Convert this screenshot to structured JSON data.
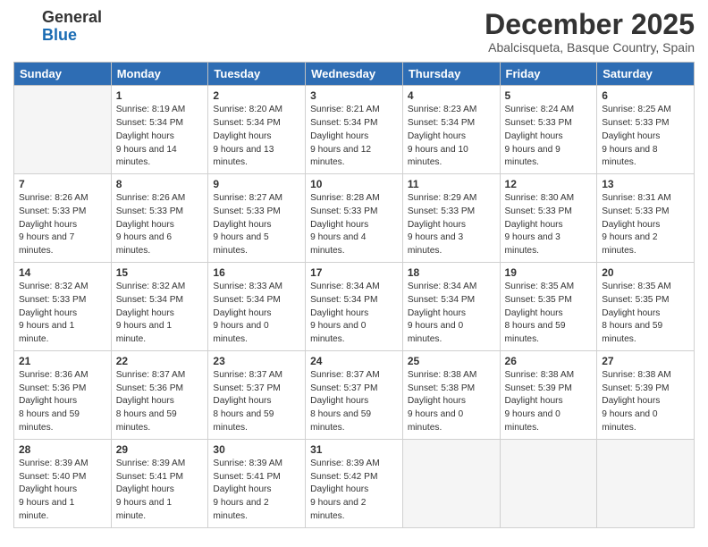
{
  "logo": {
    "general": "General",
    "blue": "Blue"
  },
  "title": "December 2025",
  "subtitle": "Abalcisqueta, Basque Country, Spain",
  "days": [
    "Sunday",
    "Monday",
    "Tuesday",
    "Wednesday",
    "Thursday",
    "Friday",
    "Saturday"
  ],
  "weeks": [
    [
      {
        "num": "",
        "sunrise": "",
        "sunset": "",
        "daylight": "",
        "empty": true
      },
      {
        "num": "1",
        "sunrise": "8:19 AM",
        "sunset": "5:34 PM",
        "daylight": "9 hours and 14 minutes."
      },
      {
        "num": "2",
        "sunrise": "8:20 AM",
        "sunset": "5:34 PM",
        "daylight": "9 hours and 13 minutes."
      },
      {
        "num": "3",
        "sunrise": "8:21 AM",
        "sunset": "5:34 PM",
        "daylight": "9 hours and 12 minutes."
      },
      {
        "num": "4",
        "sunrise": "8:23 AM",
        "sunset": "5:34 PM",
        "daylight": "9 hours and 10 minutes."
      },
      {
        "num": "5",
        "sunrise": "8:24 AM",
        "sunset": "5:33 PM",
        "daylight": "9 hours and 9 minutes."
      },
      {
        "num": "6",
        "sunrise": "8:25 AM",
        "sunset": "5:33 PM",
        "daylight": "9 hours and 8 minutes."
      }
    ],
    [
      {
        "num": "7",
        "sunrise": "8:26 AM",
        "sunset": "5:33 PM",
        "daylight": "9 hours and 7 minutes."
      },
      {
        "num": "8",
        "sunrise": "8:26 AM",
        "sunset": "5:33 PM",
        "daylight": "9 hours and 6 minutes."
      },
      {
        "num": "9",
        "sunrise": "8:27 AM",
        "sunset": "5:33 PM",
        "daylight": "9 hours and 5 minutes."
      },
      {
        "num": "10",
        "sunrise": "8:28 AM",
        "sunset": "5:33 PM",
        "daylight": "9 hours and 4 minutes."
      },
      {
        "num": "11",
        "sunrise": "8:29 AM",
        "sunset": "5:33 PM",
        "daylight": "9 hours and 3 minutes."
      },
      {
        "num": "12",
        "sunrise": "8:30 AM",
        "sunset": "5:33 PM",
        "daylight": "9 hours and 3 minutes."
      },
      {
        "num": "13",
        "sunrise": "8:31 AM",
        "sunset": "5:33 PM",
        "daylight": "9 hours and 2 minutes."
      }
    ],
    [
      {
        "num": "14",
        "sunrise": "8:32 AM",
        "sunset": "5:33 PM",
        "daylight": "9 hours and 1 minute."
      },
      {
        "num": "15",
        "sunrise": "8:32 AM",
        "sunset": "5:34 PM",
        "daylight": "9 hours and 1 minute."
      },
      {
        "num": "16",
        "sunrise": "8:33 AM",
        "sunset": "5:34 PM",
        "daylight": "9 hours and 0 minutes."
      },
      {
        "num": "17",
        "sunrise": "8:34 AM",
        "sunset": "5:34 PM",
        "daylight": "9 hours and 0 minutes."
      },
      {
        "num": "18",
        "sunrise": "8:34 AM",
        "sunset": "5:34 PM",
        "daylight": "9 hours and 0 minutes."
      },
      {
        "num": "19",
        "sunrise": "8:35 AM",
        "sunset": "5:35 PM",
        "daylight": "8 hours and 59 minutes."
      },
      {
        "num": "20",
        "sunrise": "8:35 AM",
        "sunset": "5:35 PM",
        "daylight": "8 hours and 59 minutes."
      }
    ],
    [
      {
        "num": "21",
        "sunrise": "8:36 AM",
        "sunset": "5:36 PM",
        "daylight": "8 hours and 59 minutes."
      },
      {
        "num": "22",
        "sunrise": "8:37 AM",
        "sunset": "5:36 PM",
        "daylight": "8 hours and 59 minutes."
      },
      {
        "num": "23",
        "sunrise": "8:37 AM",
        "sunset": "5:37 PM",
        "daylight": "8 hours and 59 minutes."
      },
      {
        "num": "24",
        "sunrise": "8:37 AM",
        "sunset": "5:37 PM",
        "daylight": "8 hours and 59 minutes."
      },
      {
        "num": "25",
        "sunrise": "8:38 AM",
        "sunset": "5:38 PM",
        "daylight": "9 hours and 0 minutes."
      },
      {
        "num": "26",
        "sunrise": "8:38 AM",
        "sunset": "5:39 PM",
        "daylight": "9 hours and 0 minutes."
      },
      {
        "num": "27",
        "sunrise": "8:38 AM",
        "sunset": "5:39 PM",
        "daylight": "9 hours and 0 minutes."
      }
    ],
    [
      {
        "num": "28",
        "sunrise": "8:39 AM",
        "sunset": "5:40 PM",
        "daylight": "9 hours and 1 minute."
      },
      {
        "num": "29",
        "sunrise": "8:39 AM",
        "sunset": "5:41 PM",
        "daylight": "9 hours and 1 minute."
      },
      {
        "num": "30",
        "sunrise": "8:39 AM",
        "sunset": "5:41 PM",
        "daylight": "9 hours and 2 minutes."
      },
      {
        "num": "31",
        "sunrise": "8:39 AM",
        "sunset": "5:42 PM",
        "daylight": "9 hours and 2 minutes."
      },
      {
        "num": "",
        "sunrise": "",
        "sunset": "",
        "daylight": "",
        "empty": true
      },
      {
        "num": "",
        "sunrise": "",
        "sunset": "",
        "daylight": "",
        "empty": true
      },
      {
        "num": "",
        "sunrise": "",
        "sunset": "",
        "daylight": "",
        "empty": true
      }
    ]
  ]
}
